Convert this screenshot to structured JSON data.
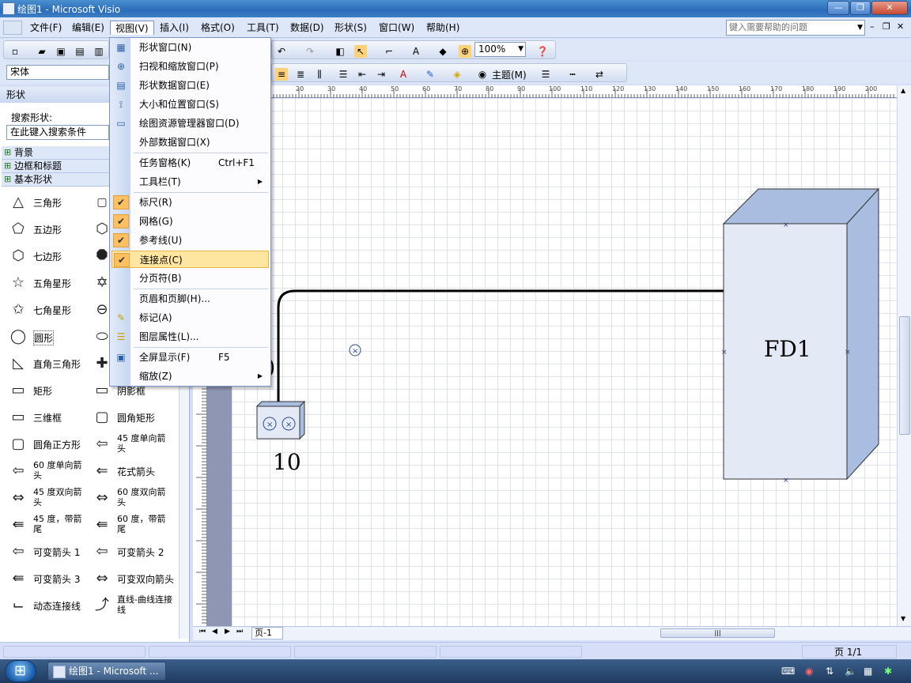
{
  "window": {
    "title": "绘图1 - Microsoft Visio"
  },
  "menubar": {
    "items": [
      "文件(F)",
      "编辑(E)",
      "视图(V)",
      "插入(I)",
      "格式(O)",
      "工具(T)",
      "数据(D)",
      "形状(S)",
      "窗口(W)",
      "帮助(H)"
    ],
    "help_placeholder": "键入需要帮助的问题"
  },
  "toolbar": {
    "font": "宋体",
    "zoom": "100%",
    "theme": "主题(M)"
  },
  "view_menu": {
    "items": [
      {
        "label": "形状窗口(N)"
      },
      {
        "label": "扫视和缩放窗口(P)"
      },
      {
        "label": "形状数据窗口(E)"
      },
      {
        "label": "大小和位置窗口(S)"
      },
      {
        "label": "绘图资源管理器窗口(D)"
      },
      {
        "label": "外部数据窗口(X)"
      },
      {
        "label": "任务窗格(K)",
        "shortcut": "Ctrl+F1"
      },
      {
        "label": "工具栏(T)"
      },
      {
        "label": "标尺(R)",
        "checked": true
      },
      {
        "label": "网格(G)",
        "checked": true
      },
      {
        "label": "参考线(U)",
        "checked": true
      },
      {
        "label": "连接点(C)",
        "checked": true
      },
      {
        "label": "分页符(B)"
      },
      {
        "label": "页眉和页脚(H)..."
      },
      {
        "label": "标记(A)"
      },
      {
        "label": "图层属性(L)..."
      },
      {
        "label": "全屏显示(F)",
        "shortcut": "F5"
      },
      {
        "label": "缩放(Z)"
      }
    ]
  },
  "shapes_panel": {
    "title": "形状",
    "search_label": "搜索形状:",
    "search_placeholder": "在此键入搜索条件",
    "stencils": [
      "背景",
      "边框和标题",
      "基本形状"
    ],
    "shapes_col1": [
      "三角形",
      "五边形",
      "七边形",
      "五角星形",
      "七角星形",
      "圆形",
      "直角三角形",
      "矩形",
      "三维框",
      "圆角正方形",
      "60 度单向箭头",
      "45 度双向箭头",
      "45 度，带箭尾",
      "可变箭头 1",
      "可变箭头 3",
      "动态连接线"
    ],
    "shapes_col2": [
      "",
      "",
      "",
      "",
      "",
      "",
      "",
      "阴影框",
      "圆角矩形",
      "45 度单向箭头",
      "花式箭头",
      "60 度双向箭头",
      "60 度，带箭尾",
      "可变箭头 2",
      "可变双向箭头",
      "直线-曲线连接线"
    ]
  },
  "ruler": {
    "ticks": [
      "20",
      "30",
      "40",
      "50",
      "60",
      "70",
      "80",
      "90",
      "100",
      "110",
      "120",
      "130",
      "140",
      "150",
      "160",
      "170",
      "180",
      "190",
      "200"
    ]
  },
  "canvas": {
    "shape_fd_label": "FD1",
    "shape_small_label": "10",
    "partial_label": ")"
  },
  "bottom": {
    "page_tab": "页-1"
  },
  "status": {
    "page": "页 1/1"
  },
  "taskbar": {
    "item": "绘图1 - Microsoft ..."
  }
}
